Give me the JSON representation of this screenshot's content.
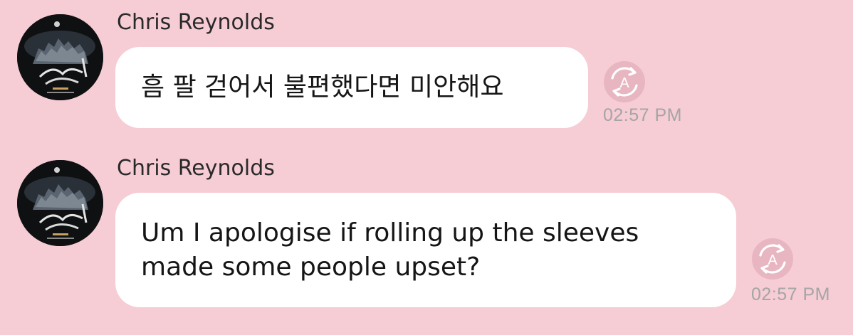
{
  "messages": [
    {
      "sender": "Chris Reynolds",
      "text": "흠 팔 걷어서 불편했다면 미안해요",
      "time": "02:57 PM",
      "translate_icon": "translate-icon",
      "avatar_icon": "profile-photo"
    },
    {
      "sender": "Chris Reynolds",
      "text": "Um I apologise if rolling up the sleeves made some people upset?",
      "time": "02:57 PM",
      "translate_icon": "translate-icon",
      "avatar_icon": "profile-photo"
    }
  ],
  "colors": {
    "background": "#f6ccd5",
    "bubble": "#ffffff",
    "icon": "#e8b6c1",
    "timestamp": "#a5a5a5"
  }
}
